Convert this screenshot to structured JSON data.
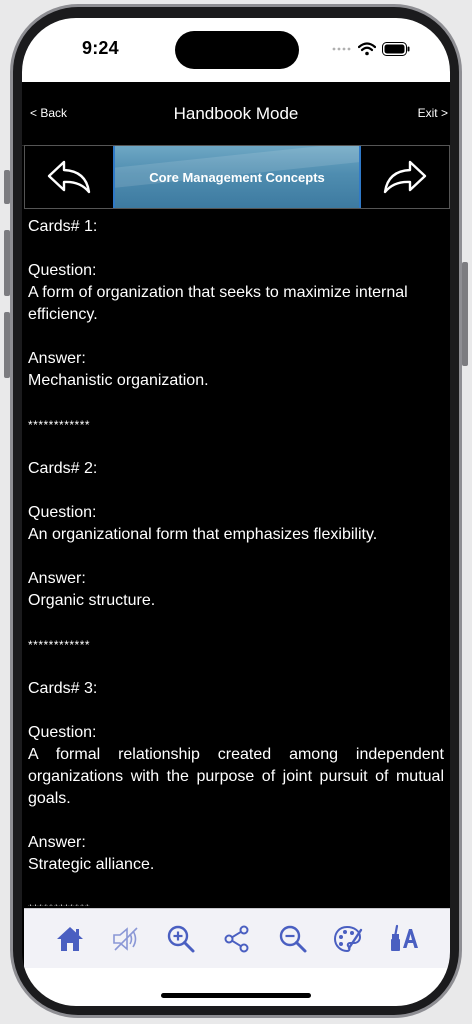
{
  "status_bar": {
    "time": "9:24"
  },
  "nav": {
    "back_label": "< Back",
    "title": "Handbook Mode",
    "exit_label": "Exit >"
  },
  "deck": {
    "title": "Core Management Concepts"
  },
  "labels": {
    "question": "Question:",
    "answer": "Answer:",
    "separator": "************"
  },
  "cards": [
    {
      "heading": "Cards# 1:",
      "question": "A form of organization that seeks to maximize internal efficiency.",
      "answer": "Mechanistic organization."
    },
    {
      "heading": "Cards# 2:",
      "question": "An organizational form that emphasizes flexibility.",
      "answer": "Organic structure."
    },
    {
      "heading": "Cards# 3:",
      "question": "A formal relationship created among independent organizations with the purpose of joint pursuit of mutual goals.",
      "answer": "Strategic alliance."
    }
  ],
  "toolbar": {
    "icons": [
      "home-icon",
      "speaker-mute-icon",
      "zoom-in-icon",
      "share-icon",
      "zoom-out-icon",
      "palette-icon",
      "font-style-icon"
    ],
    "icon_color": "#4a5fc1"
  }
}
